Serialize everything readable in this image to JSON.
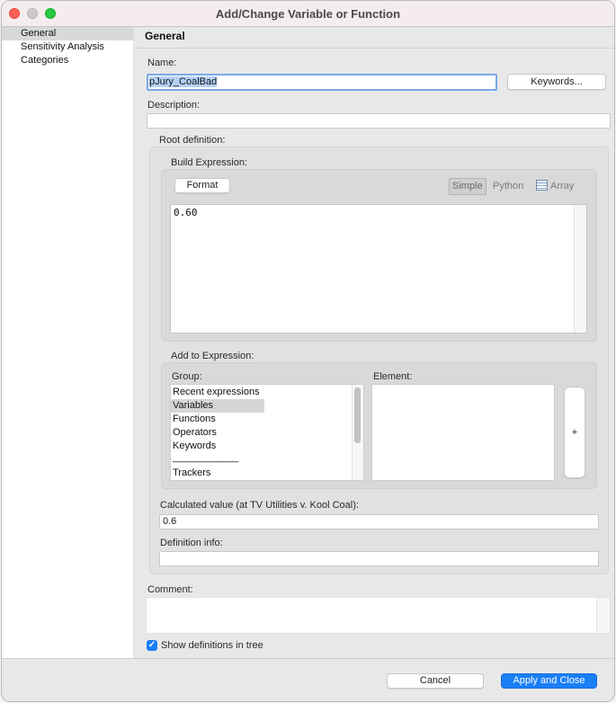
{
  "window": {
    "title": "Add/Change Variable or Function"
  },
  "sidebar": {
    "items": [
      {
        "label": "General",
        "selected": true
      },
      {
        "label": "Sensitivity Analysis",
        "selected": false
      },
      {
        "label": "Categories",
        "selected": false
      }
    ]
  },
  "main": {
    "header": "General",
    "name_label": "Name:",
    "name_value": "pJury_CoalBad",
    "keywords_button": "Keywords...",
    "description_label": "Description:",
    "description_value": "",
    "root_definition_label": "Root definition:",
    "build_expression_label": "Build Expression:",
    "format_button": "Format",
    "modes": {
      "simple": "Simple",
      "python": "Python",
      "array": "Array",
      "active": "Simple"
    },
    "expression_value": "0.60",
    "add_to_expression_label": "Add to Expression:",
    "group_label": "Group:",
    "group_items": [
      {
        "label": "Recent expressions",
        "selected": false
      },
      {
        "label": "Variables",
        "selected": true
      },
      {
        "label": "Functions",
        "selected": false
      },
      {
        "label": "Operators",
        "selected": false
      },
      {
        "label": "Keywords",
        "selected": false
      },
      {
        "label": "____________",
        "selected": false
      },
      {
        "label": "Trackers",
        "selected": false
      }
    ],
    "element_label": "Element:",
    "element_items": [],
    "add_button": "+",
    "calculated_value_label": "Calculated value (at TV Utilities v.  Kool Coal):",
    "calculated_value": "0.6",
    "definition_info_label": "Definition info:",
    "definition_info_value": "",
    "comment_label": "Comment:",
    "comment_value": "",
    "show_definitions_label": "Show definitions in tree",
    "show_definitions_checked": true
  },
  "footer": {
    "cancel_button": "Cancel",
    "apply_button": "Apply and Close"
  },
  "colors": {
    "accent": "#1a7ef6",
    "close": "#fe5f57",
    "maximize": "#28c840"
  }
}
